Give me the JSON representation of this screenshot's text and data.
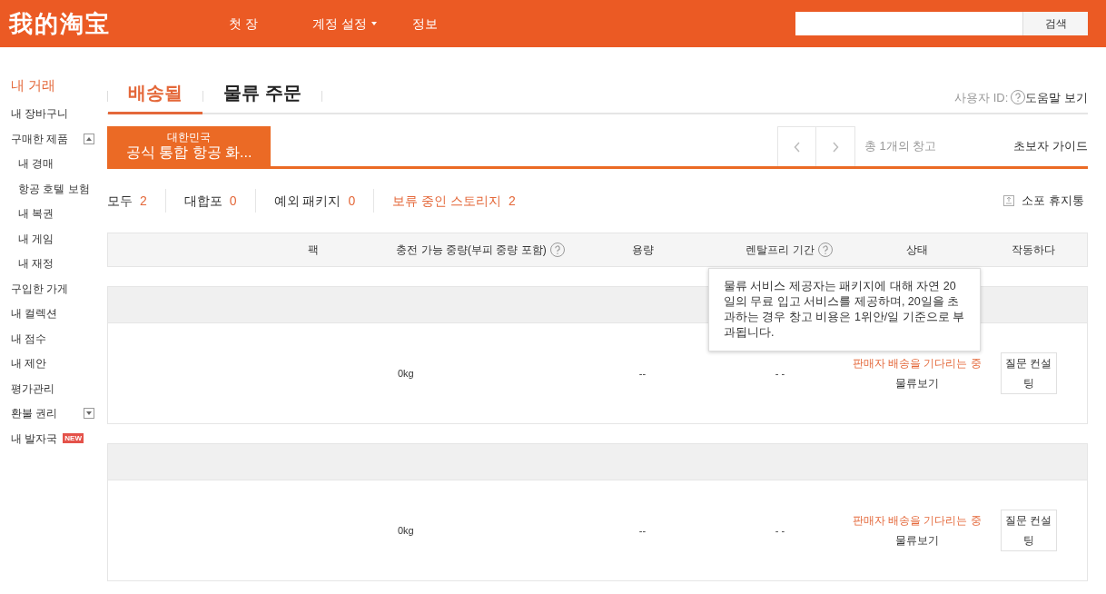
{
  "header": {
    "logo": "我的淘宝",
    "nav": [
      {
        "label": "첫 장",
        "dropdown": false
      },
      {
        "label": "계정 설정",
        "dropdown": true
      },
      {
        "label": "정보",
        "dropdown": false
      }
    ],
    "search": {
      "button": "검색"
    }
  },
  "sidebar": {
    "items": [
      {
        "label": "내 거래",
        "kind": "heading",
        "selected": true
      },
      {
        "label": "내 장바구니",
        "kind": "item",
        "selected": false
      },
      {
        "label": "구매한 제품",
        "kind": "group",
        "selected": false,
        "expanded": true,
        "children": [
          {
            "label": "내 경매",
            "kind": "item",
            "selected": false
          },
          {
            "label": "항공 호텔 보험",
            "kind": "item",
            "selected": false
          },
          {
            "label": "내 복권",
            "kind": "item",
            "selected": false
          },
          {
            "label": "내 게임",
            "kind": "item",
            "selected": false
          },
          {
            "label": "내 재정",
            "kind": "item",
            "selected": false
          }
        ]
      },
      {
        "label": "구입한 가게",
        "kind": "item",
        "selected": false
      },
      {
        "label": "내 컬렉션",
        "kind": "item",
        "selected": false
      },
      {
        "label": "내 점수",
        "kind": "item",
        "selected": false
      },
      {
        "label": "내 제안",
        "kind": "item",
        "selected": false
      },
      {
        "label": "평가관리",
        "kind": "item",
        "selected": false
      },
      {
        "label": "환불 권리",
        "kind": "group",
        "selected": false,
        "expanded": false
      },
      {
        "label": "내 발자국",
        "kind": "item",
        "selected": false,
        "badge": "NEW"
      }
    ]
  },
  "tabs": [
    {
      "label": "배송될",
      "selected": true
    },
    {
      "label": "물류 주문",
      "selected": false
    }
  ],
  "user_id_label": "사용자 ID:",
  "help_link": "도움말 보기",
  "warehouses": [
    {
      "country": "대한민국",
      "name": "공식 통합 항공 화...",
      "selected": true
    }
  ],
  "warehouse_count": "총 1개의 창고",
  "guide_link": "초보자 가이드",
  "filters": [
    {
      "label": "모두",
      "count": "2",
      "selected": false
    },
    {
      "label": "대합포",
      "count": "0",
      "selected": false
    },
    {
      "label": "예외 패키지",
      "count": "0",
      "selected": false
    },
    {
      "label": "보류 중인 스토리지",
      "count": "2",
      "selected": true
    }
  ],
  "trash_link": "소포 휴지통",
  "table": {
    "columns": [
      {
        "label": "팩",
        "help": false
      },
      {
        "label": "충전 가능 중량(부피 중량 포함)",
        "help": true
      },
      {
        "label": "용량",
        "help": false
      },
      {
        "label": "렌탈프리 기간",
        "help": true
      },
      {
        "label": "상태",
        "help": false
      },
      {
        "label": "작동하다",
        "help": false
      }
    ],
    "rows": [
      {
        "weight": "0kg",
        "capacity": "--",
        "rental": "- -",
        "status": "판매자 배송을 기다리는 중",
        "logistics": "물류보기",
        "action": "질문 컨설팅"
      },
      {
        "weight": "0kg",
        "capacity": "--",
        "rental": "- -",
        "status": "판매자 배송을 기다리는 중",
        "logistics": "물류보기",
        "action": "질문 컨설팅"
      }
    ]
  },
  "tooltip": "물류 서비스 제공자는 패키지에 대해 자연 20일의 무료 입고 서비스를 제공하며, 20일을 초과하는 경우 창고 비용은 1위안/일 기준으로 부과됩니다."
}
